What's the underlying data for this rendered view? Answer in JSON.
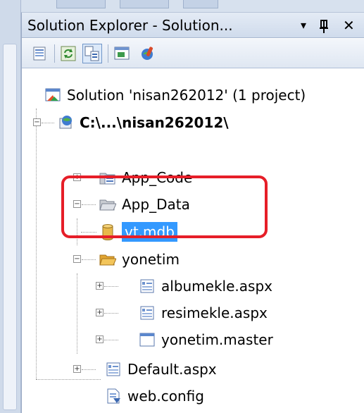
{
  "titlebar": {
    "title": "Solution Explorer - Solution...",
    "controls": {
      "dropdown": "▾",
      "pin": "ᚋ",
      "close": "✕"
    }
  },
  "toolbar": {
    "buttons": [
      {
        "icon": "properties-icon"
      },
      {
        "icon": "refresh-icon"
      },
      {
        "icon": "nest-related-files-icon",
        "active": true
      },
      {
        "icon": "view-designer-icon"
      },
      {
        "icon": "aspnet-config-icon"
      }
    ]
  },
  "tree": {
    "solution": "Solution 'nisan262012' (1 project)",
    "project": "C:\\...\\nisan262012\\",
    "items": [
      {
        "label": "App_Code",
        "icon": "app-code-folder-icon"
      },
      {
        "label": "App_Data",
        "icon": "folder-open-icon"
      },
      {
        "label": "vt.mdb",
        "icon": "database-icon",
        "selected": true
      },
      {
        "label": "yonetim",
        "icon": "folder-open-icon"
      },
      {
        "label": "albumekle.aspx",
        "icon": "aspx-page-icon"
      },
      {
        "label": "resimekle.aspx",
        "icon": "aspx-page-icon"
      },
      {
        "label": "yonetim.master",
        "icon": "master-page-icon"
      },
      {
        "label": "Default.aspx",
        "icon": "aspx-page-icon"
      },
      {
        "label": "web.config",
        "icon": "config-file-icon"
      }
    ],
    "expanders": {
      "collapsed": "+",
      "expanded": "−"
    }
  },
  "colors": {
    "selection": "#3399ff",
    "callout": "#e61e28",
    "folder": "#e8b84a"
  }
}
